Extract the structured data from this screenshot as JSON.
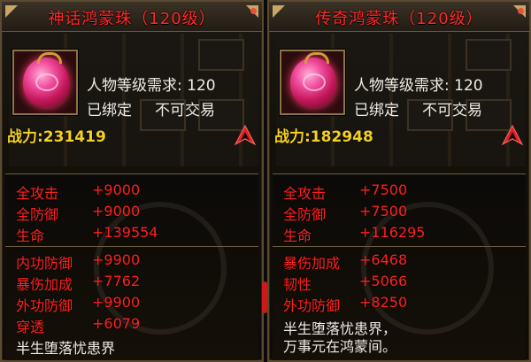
{
  "panels": [
    {
      "title": "神话鸿蒙珠（120级）",
      "requirement": "人物等级需求: 120",
      "bound": "已绑定",
      "tradable": "不可交易",
      "power": "战力:231419",
      "stats": [
        {
          "name": "全攻击",
          "value": "+9000"
        },
        {
          "name": "全防御",
          "value": "+9000"
        },
        {
          "name": "生命",
          "value": "+139554"
        },
        {
          "name": "内功防御",
          "value": "+9900"
        },
        {
          "name": "暴伤加成",
          "value": "+7762"
        },
        {
          "name": "外功防御",
          "value": "+9900"
        },
        {
          "name": "穿透",
          "value": "+6079"
        }
      ],
      "description": "半生堕落忧患界"
    },
    {
      "title": "传奇鸿蒙珠（120级）",
      "requirement": "人物等级需求: 120",
      "bound": "已绑定",
      "tradable": "不可交易",
      "power": "战力:182948",
      "stats": [
        {
          "name": "全攻击",
          "value": "+7500"
        },
        {
          "name": "全防御",
          "value": "+7500"
        },
        {
          "name": "生命",
          "value": "+116295"
        },
        {
          "name": "暴伤加成",
          "value": "+6468"
        },
        {
          "name": "韧性",
          "value": "+5066"
        },
        {
          "name": "外功防御",
          "value": "+8250"
        }
      ],
      "description": "半生堕落忧患界，",
      "description2": "万事元在鸿蒙间。"
    }
  ],
  "colors": {
    "title": "#ff2a2a",
    "stat": "#ff2020",
    "power": "#f4d020",
    "text": "#f0ece4",
    "arrow": "#e02020"
  },
  "icons": {
    "item": "pink-orb-icon",
    "upgrade": "red-up-arrow-icon"
  }
}
